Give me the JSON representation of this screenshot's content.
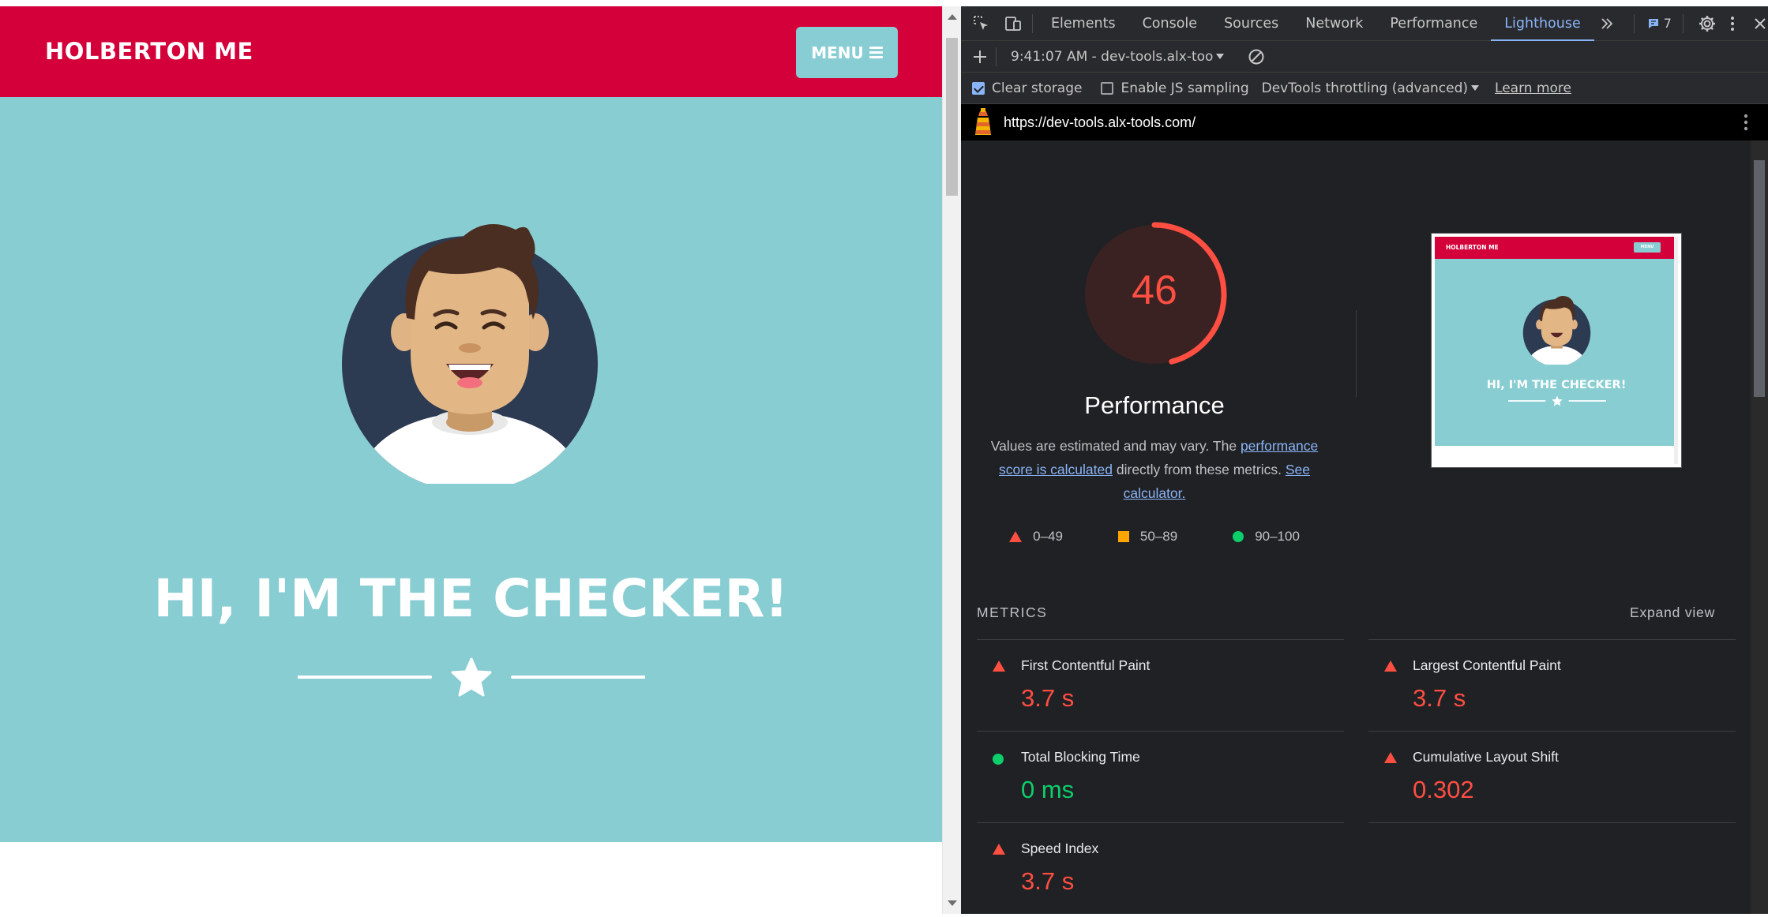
{
  "site": {
    "brand": "HOLBERTON ME",
    "menu_label": "MENU",
    "hero_title": "HI, I'M THE CHECKER!",
    "colors": {
      "header": "#d3003a",
      "hero": "#88cdd2",
      "menu_button": "#88cdd3"
    }
  },
  "devtools": {
    "tabs": [
      "Elements",
      "Console",
      "Sources",
      "Network",
      "Performance",
      "Lighthouse"
    ],
    "active_tab": "Lighthouse",
    "issues_count": "7",
    "report_selector": "9:41:07 AM - dev-tools.alx-too",
    "options": {
      "clear_storage": "Clear storage",
      "js_sampling": "Enable JS sampling",
      "throttling": "DevTools throttling (advanced)",
      "learn_more": "Learn more"
    },
    "url": "https://dev-tools.alx-tools.com/"
  },
  "report": {
    "score": 46,
    "score_color": "#ff4e42",
    "category": "Performance",
    "desc_1": "Values are estimated and may vary. The",
    "desc_link_1": "performance score is calculated",
    "desc_2": "directly from these metrics.",
    "desc_link_2": "See calculator.",
    "legend": {
      "fail": "0–49",
      "average": "50–89",
      "pass": "90–100"
    },
    "metrics_label": "METRICS",
    "expand_label": "Expand view",
    "metrics": [
      {
        "name": "First Contentful Paint",
        "value": "3.7 s",
        "status": "fail"
      },
      {
        "name": "Largest Contentful Paint",
        "value": "3.7 s",
        "status": "fail"
      },
      {
        "name": "Total Blocking Time",
        "value": "0 ms",
        "status": "pass"
      },
      {
        "name": "Cumulative Layout Shift",
        "value": "0.302",
        "status": "fail"
      },
      {
        "name": "Speed Index",
        "value": "3.7 s",
        "status": "fail"
      }
    ],
    "thumbnail": {
      "brand": "HOLBERTON ME",
      "menu": "MENU",
      "title": "HI, I'M THE CHECKER!"
    }
  }
}
